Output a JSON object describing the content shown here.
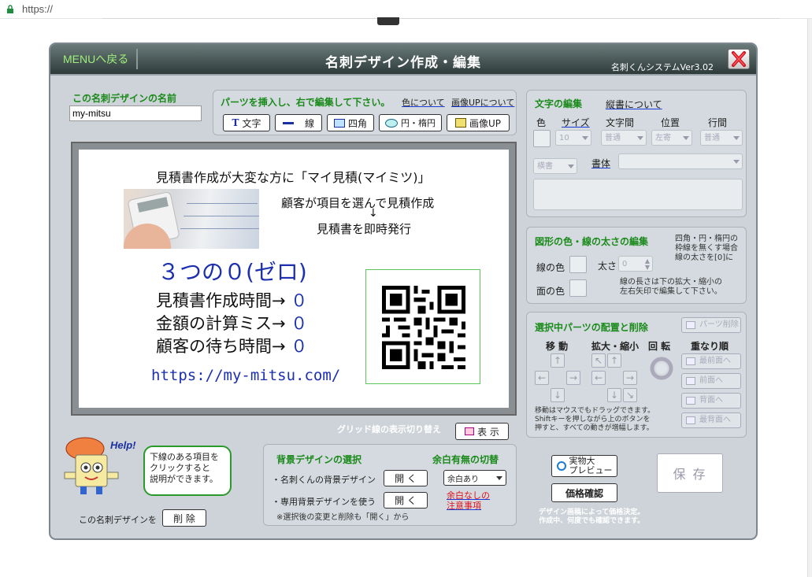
{
  "browser": {
    "url": "https://"
  },
  "window": {
    "menu_back": "MENUへ戻る",
    "title": "名刺デザイン作成・編集",
    "version": "名刺くんシステムVer3.02",
    "close_label": "X"
  },
  "design_name": {
    "label": "この名刺デザインの名前",
    "value": "my-mitsu"
  },
  "parts": {
    "heading": "パーツを挿入し、右で編集して下さい。",
    "color_link": "色について",
    "image_link": "画像UPについて",
    "buttons": [
      {
        "icon": "T",
        "label": "文字"
      },
      {
        "icon": "line",
        "label": "線"
      },
      {
        "icon": "rect",
        "label": "四角"
      },
      {
        "icon": "ellipse",
        "label": "円・楕円"
      },
      {
        "icon": "image",
        "label": "画像UP"
      }
    ]
  },
  "card": {
    "headline": "見積書作成が大変な方に「マイ見積(マイミツ)」",
    "line1": "顧客が項目を選んで見積作成",
    "arrow": "↓",
    "line2": "見積書を即時発行",
    "big": "３つの０(ゼロ)",
    "rows": [
      {
        "text": "見積書作成時間→",
        "zero": "０"
      },
      {
        "text": "金額の計算ミス→",
        "zero": "０"
      },
      {
        "text": "顧客の待ち時間→",
        "zero": "０"
      }
    ],
    "url": "https://my-mitsu.com/"
  },
  "grid_toggle": {
    "label": "グリッド線の表示切り替え",
    "button": "表 示"
  },
  "help": {
    "badge": "Help!",
    "bubble": "下線のある項目を\nクリックすると\n説明ができます。",
    "delete_label": "この名刺デザインを",
    "delete_button": "削 除"
  },
  "background": {
    "heading": "背景デザインの選択",
    "row1": "・名刺くんの背景デザイン",
    "row2": "・専用背景デザインを使う",
    "open_button": "開 く",
    "note": "※選択後の変更と削除も「開く」から",
    "margin_heading": "余白有無の切替",
    "margin_value": "余白あり",
    "margin_note": "余白なしの\n注意事項"
  },
  "text_edit": {
    "heading": "文字の編集",
    "vertical_link": "縦書について",
    "col_color": "色",
    "col_size": "サイズ",
    "col_spacing": "文字間",
    "col_position": "位置",
    "col_line": "行間",
    "size_value": "10",
    "spacing_value": "普通",
    "position_value": "左寄",
    "line_value": "普通",
    "direction_value": "横書",
    "font_label": "書体"
  },
  "shape_edit": {
    "heading": "図形の色・線の太さの編集",
    "note": "四角・円・楕円の\n枠線を無くす場合\n線の太さを[0]に",
    "line_color": "線の色",
    "thickness": "太さ",
    "thickness_value": "0",
    "fill_color": "面の色",
    "line_note": "線の長さは下の拡大・縮小の\n左右矢印で編集して下さい。"
  },
  "arrange": {
    "heading": "選択中パーツの配置と削除",
    "delete_button": "パーツ削除",
    "move": "移 動",
    "scale": "拡大・縮小",
    "rotate": "回 転",
    "order": "重なり順",
    "order_buttons": [
      "最前面へ",
      "前面へ",
      "背面へ",
      "最背面へ"
    ],
    "note": "移動はマウスでもドラッグできます。\nShiftキーを押しながら上のボタンを\n押すと、すべての動きが増幅します。"
  },
  "actions": {
    "preview": "実物大\nプレビュー",
    "price": "価格確認",
    "save": "保 存",
    "note": "デザイン画稿によって価格決定。\n作成中、何度でも確認できます。"
  },
  "colors": {
    "green": "#1a8a1a",
    "blue": "#1b2fb0",
    "red": "#e0101a",
    "title_bg": "#3a4948"
  }
}
